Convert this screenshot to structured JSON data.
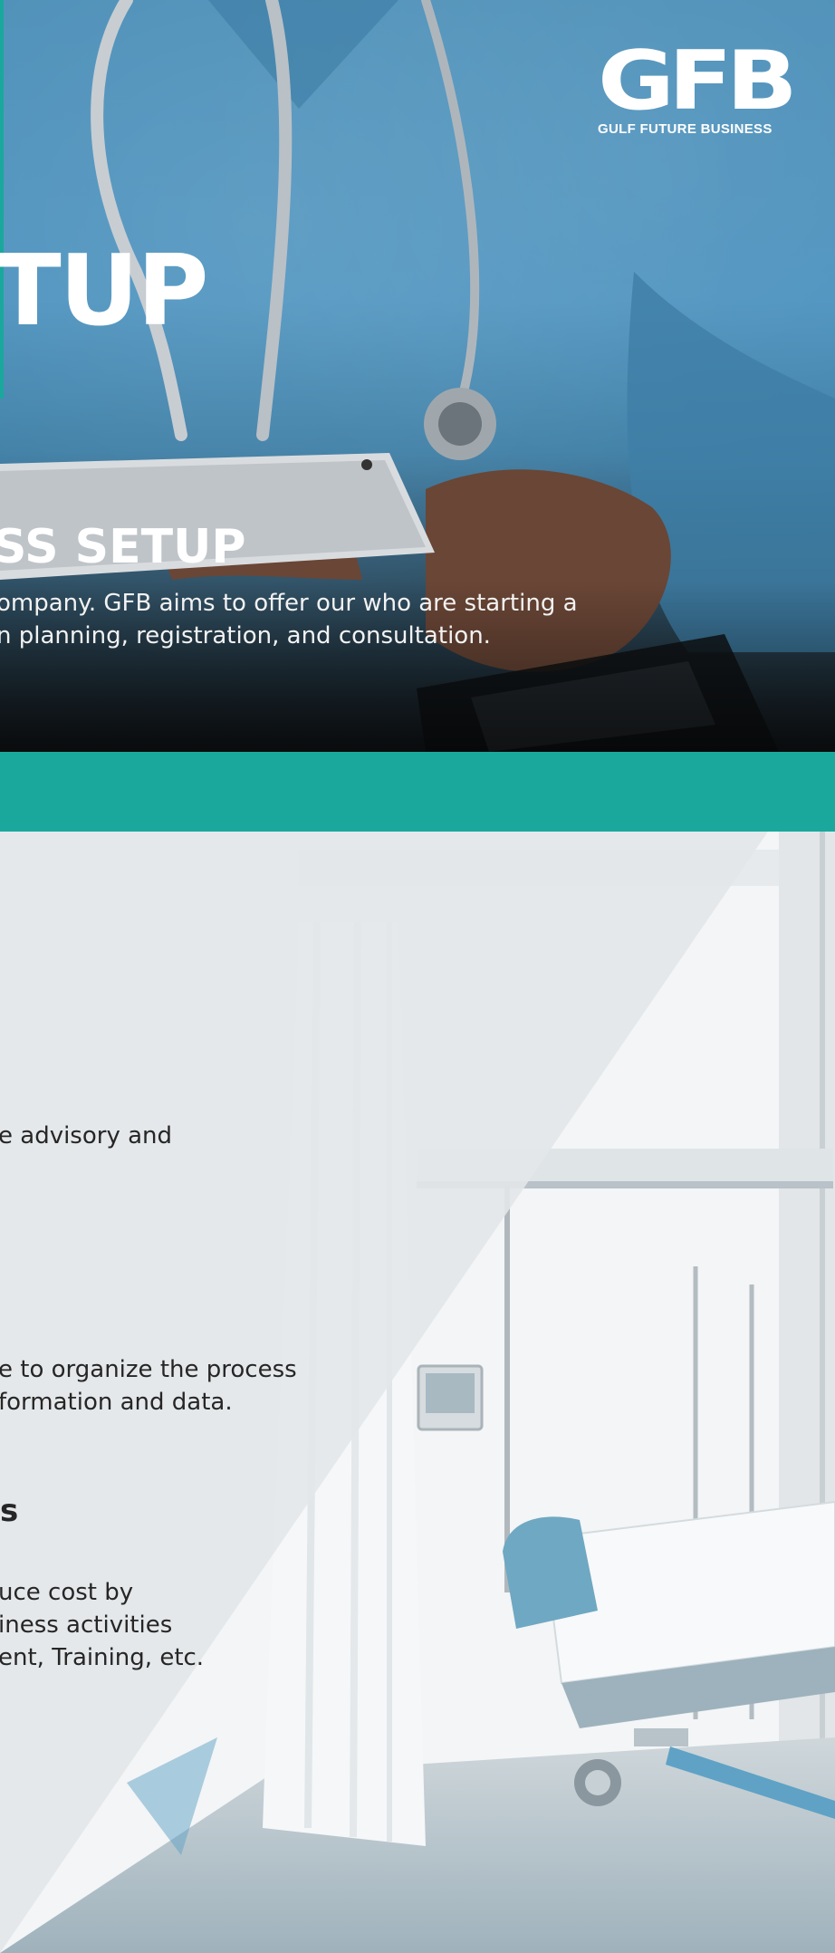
{
  "brand": {
    "logo_text": "GFB",
    "tagline": "GULF FUTURE BUSINESS"
  },
  "hero": {
    "title": "TUP",
    "subtitle": "SS SETUP",
    "description_lines": [
      "ompany. GFB aims to offer our who are starting a",
      "n planning, registration, and consultation."
    ]
  },
  "section": {
    "paragraph_1": [
      "e advisory and"
    ],
    "paragraph_2": [
      "e to organize the process",
      "formation and data."
    ],
    "heading_fragment": "s",
    "paragraph_3": [
      "uce cost by",
      "iness activities",
      "ent, Training, etc."
    ]
  },
  "colors": {
    "teal_accent": "#1aa89c",
    "scrubs_blue": "#4d93bf",
    "text_dark": "#262626"
  }
}
